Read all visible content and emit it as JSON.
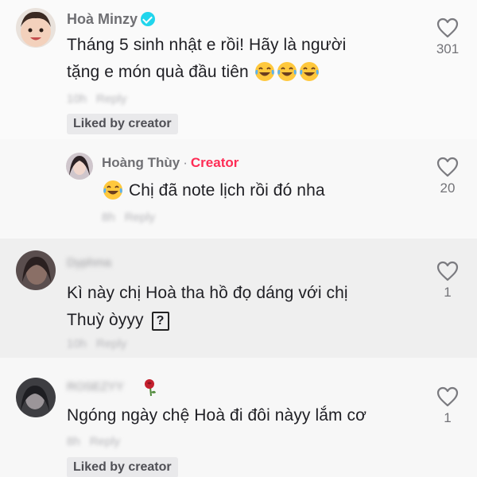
{
  "comments": [
    {
      "username": "Hoà Minzy",
      "text_line1": "Tháng 5 sinh nhật e rồi! Hãy là người",
      "text_line2": "tặng e món quà đầu tiên",
      "time": "10h",
      "reply_label": "Reply",
      "liked_by_creator": "Liked by creator",
      "likes": "301"
    },
    {
      "username": "Hoàng Thùy",
      "separator": "·",
      "creator_label": "Creator",
      "text": "Chị đã note lịch rồi đó nha",
      "time": "8h",
      "reply_label": "Reply",
      "likes": "20"
    },
    {
      "username": "Dyphma",
      "text_line1": "Kì này chị Hoà tha hồ đọ dáng với chị",
      "text_line2": "Thuỳ òyyy",
      "unknown_glyph": "?",
      "time": "10h",
      "reply_label": "Reply",
      "likes": "1"
    },
    {
      "username": "ROSEZYY",
      "text": "Ngóng ngày chệ Hoà đi đôi nàyy lắm cơ",
      "time": "8h",
      "reply_label": "Reply",
      "liked_by_creator": "Liked by creator",
      "likes": "1"
    }
  ],
  "icons": {
    "like": "heart-outline-icon",
    "emoji": "tears-of-joy-emoji",
    "verified": "verified-badge-icon",
    "rose": "rose-emoji"
  },
  "colors": {
    "creator": "#fe2c55",
    "verified": "#20d5ec",
    "heart_stroke": "#7a7a7f"
  }
}
